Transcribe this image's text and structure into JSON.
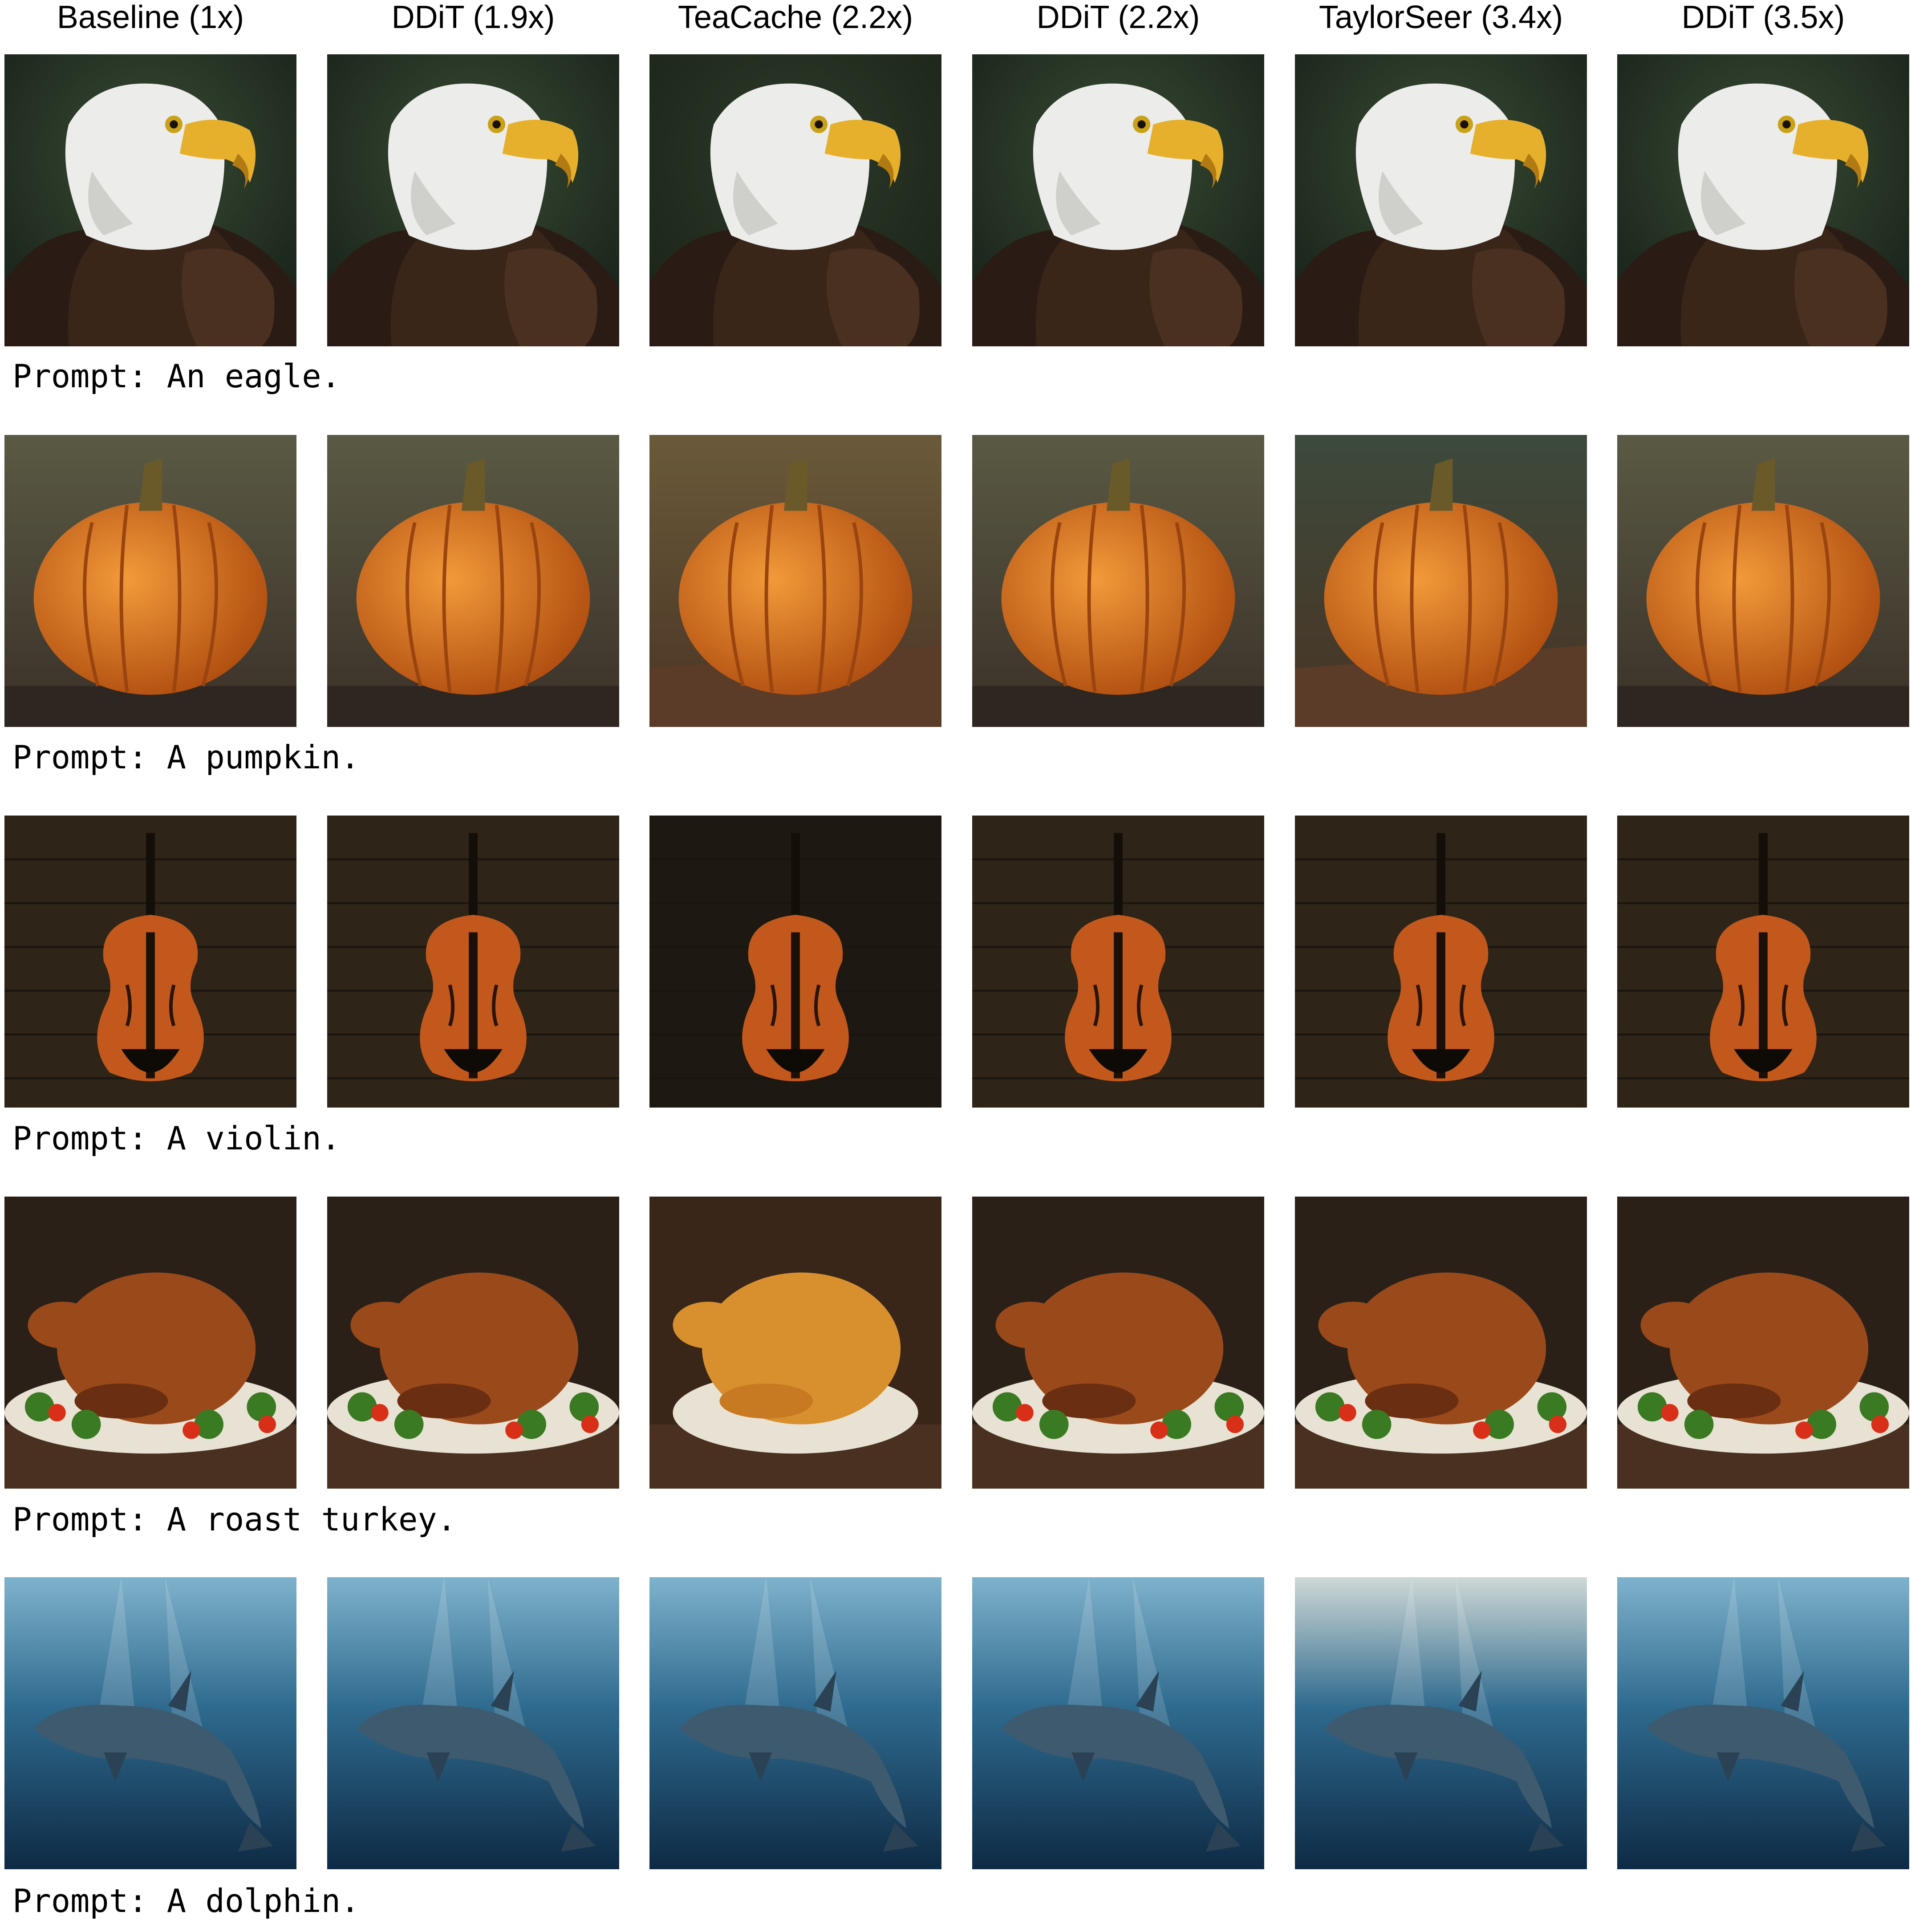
{
  "columns": [
    "Baseline (1x)",
    "DDiT (1.9x)",
    "TeaCache (2.2x)",
    "DDiT (2.2x)",
    "TaylorSeer (3.4x)",
    "DDiT (3.5x)"
  ],
  "rows": [
    {
      "subject": "eagle",
      "prompt": "Prompt: An eagle.",
      "image_names": [
        "eagle-image-baseline",
        "eagle-image-ddit-1-9x",
        "eagle-image-teacache",
        "eagle-image-ddit-2-2x",
        "eagle-image-taylorseer",
        "eagle-image-ddit-3-5x"
      ]
    },
    {
      "subject": "pumpkin",
      "prompt": "Prompt: A pumpkin.",
      "image_names": [
        "pumpkin-image-baseline",
        "pumpkin-image-ddit-1-9x",
        "pumpkin-image-teacache",
        "pumpkin-image-ddit-2-2x",
        "pumpkin-image-taylorseer",
        "pumpkin-image-ddit-3-5x"
      ]
    },
    {
      "subject": "violin",
      "prompt": "Prompt: A violin.",
      "image_names": [
        "violin-image-baseline",
        "violin-image-ddit-1-9x",
        "violin-image-teacache",
        "violin-image-ddit-2-2x",
        "violin-image-taylorseer",
        "violin-image-ddit-3-5x"
      ]
    },
    {
      "subject": "turkey",
      "prompt": "Prompt: A roast turkey.",
      "image_names": [
        "turkey-image-baseline",
        "turkey-image-ddit-1-9x",
        "turkey-image-teacache",
        "turkey-image-ddit-2-2x",
        "turkey-image-taylorseer",
        "turkey-image-ddit-3-5x"
      ]
    },
    {
      "subject": "dolphin",
      "prompt": "Prompt: A dolphin.",
      "image_names": [
        "dolphin-image-baseline",
        "dolphin-image-ddit-1-9x",
        "dolphin-image-teacache",
        "dolphin-image-ddit-2-2x",
        "dolphin-image-taylorseer",
        "dolphin-image-ddit-3-5x"
      ]
    }
  ]
}
